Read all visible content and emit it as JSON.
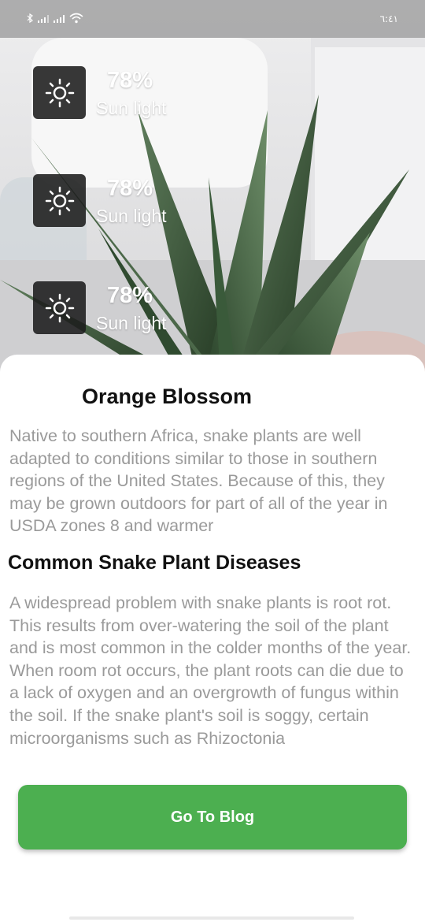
{
  "status_bar": {
    "time": "٦:٤١",
    "icons": [
      "bluetooth-icon",
      "signal-icon",
      "signal-icon",
      "wifi-icon"
    ]
  },
  "stats": [
    {
      "icon": "sun-icon",
      "value": "78%",
      "label": "Sun light"
    },
    {
      "icon": "sun-icon",
      "value": "78%",
      "label": "Sun light"
    },
    {
      "icon": "sun-icon",
      "value": "78%",
      "label": "Sun light"
    }
  ],
  "plant": {
    "name": "Orange Blossom",
    "description": "Native to southern Africa, snake plants are well adapted to conditions similar to those in southern regions of the United States. Because of this, they may be grown outdoors for part of all of the year in USDA zones 8 and warmer"
  },
  "diseases": {
    "title": "Common Snake Plant Diseases",
    "description": "A widespread problem with snake plants is root rot. This results from over-watering the soil of the plant and is most common in the colder months of the year. When room rot occurs, the plant roots can die due to a lack of oxygen and an overgrowth of fungus within the soil. If the snake plant's soil is soggy, certain microorganisms such as Rhizoctonia"
  },
  "actions": {
    "blog_button": "Go To Blog"
  },
  "colors": {
    "accent": "#4caf50",
    "chip_bg": "#1c1c1c",
    "muted_text": "#9a9a9a"
  }
}
